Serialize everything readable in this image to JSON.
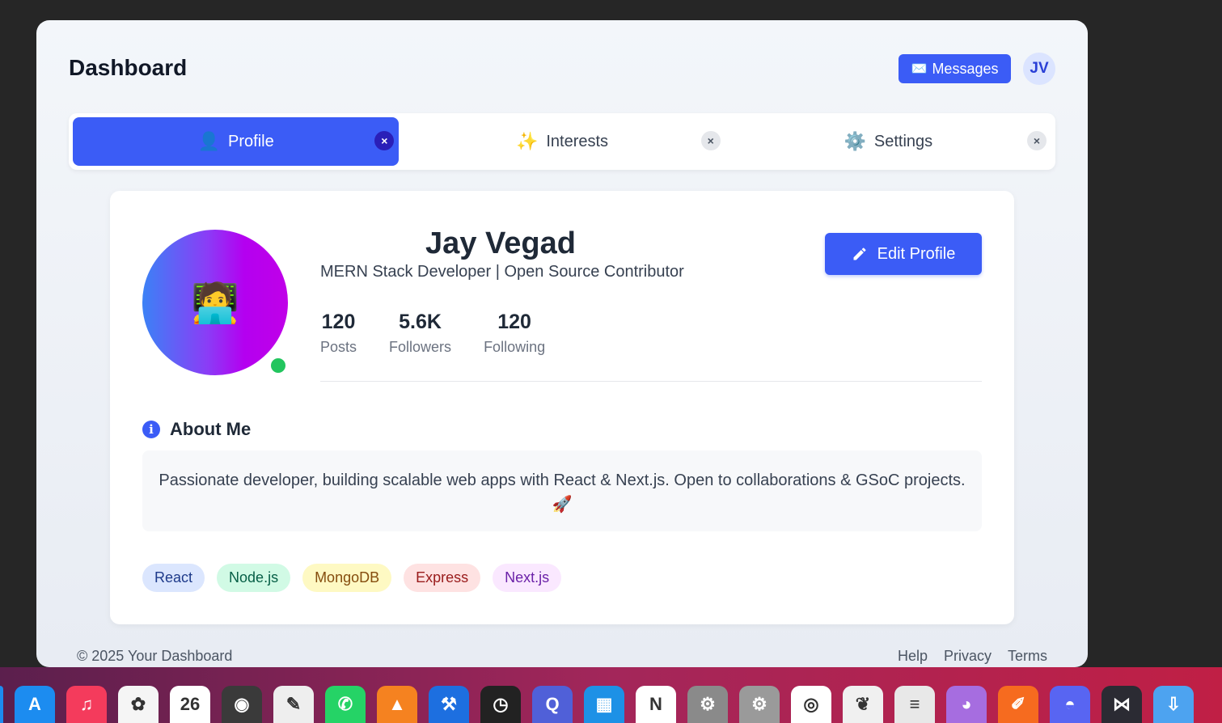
{
  "header": {
    "title": "Dashboard",
    "messages_icon": "✉️",
    "messages_label": "Messages",
    "avatar_initials": "JV"
  },
  "tabs": [
    {
      "icon": "👤",
      "label": "Profile",
      "active": true,
      "close": "×"
    },
    {
      "icon": "✨",
      "label": "Interests",
      "active": false,
      "close": "×"
    },
    {
      "icon": "⚙️",
      "label": "Settings",
      "active": false,
      "close": "×"
    }
  ],
  "profile": {
    "avatar_emoji": "🧑‍💻",
    "name": "Jay Vegad",
    "role": "MERN Stack Developer | Open Source Contributor",
    "edit_label": "Edit Profile",
    "stats": [
      {
        "value": "120",
        "label": "Posts"
      },
      {
        "value": "5.6K",
        "label": "Followers"
      },
      {
        "value": "120",
        "label": "Following"
      }
    ]
  },
  "about": {
    "heading": "About Me",
    "text": "Passionate developer, building scalable web apps with React & Next.js. Open to collaborations & GSoC projects. 🚀"
  },
  "tags": [
    {
      "label": "React",
      "bg": "#dbe6fe",
      "fg": "#1e3a8a"
    },
    {
      "label": "Node.js",
      "bg": "#d1fae5",
      "fg": "#065f46"
    },
    {
      "label": "MongoDB",
      "bg": "#fef9c3",
      "fg": "#854d0e"
    },
    {
      "label": "Express",
      "bg": "#fee2e2",
      "fg": "#991b1b"
    },
    {
      "label": "Next.js",
      "bg": "#fae8ff",
      "fg": "#6b21a8"
    }
  ],
  "footer": {
    "copyright": "© 2025 Your Dashboard",
    "links": [
      "Help",
      "Privacy",
      "Terms"
    ]
  },
  "colors": {
    "accent": "#3b5cf6",
    "online": "#22c55e"
  },
  "dock": [
    {
      "name": "app-store-icon",
      "bg": "#1c8cf0",
      "glyph": "A"
    },
    {
      "name": "music-icon",
      "bg": "#f43b5c",
      "glyph": "♫"
    },
    {
      "name": "photos-icon",
      "bg": "#f5f5f5",
      "glyph": "✿"
    },
    {
      "name": "calendar-icon",
      "bg": "#ffffff",
      "glyph": "26"
    },
    {
      "name": "obs-icon",
      "bg": "#3a3a3a",
      "glyph": "◉"
    },
    {
      "name": "textedit-icon",
      "bg": "#eeeeee",
      "glyph": "✎"
    },
    {
      "name": "whatsapp-icon",
      "bg": "#25d366",
      "glyph": "✆"
    },
    {
      "name": "vlc-icon",
      "bg": "#f58220",
      "glyph": "▲"
    },
    {
      "name": "xcode-icon",
      "bg": "#1d6fe0",
      "glyph": "⚒"
    },
    {
      "name": "clock-icon",
      "bg": "#222222",
      "glyph": "◷"
    },
    {
      "name": "quicktime-icon",
      "bg": "#5060d8",
      "glyph": "Q"
    },
    {
      "name": "docker-icon",
      "bg": "#1d91e6",
      "glyph": "▦"
    },
    {
      "name": "notion-icon",
      "bg": "#ffffff",
      "glyph": "N"
    },
    {
      "name": "system-settings-icon",
      "bg": "#8a8a8a",
      "glyph": "⚙"
    },
    {
      "name": "settings-alt-icon",
      "bg": "#9a9a9a",
      "glyph": "⚙"
    },
    {
      "name": "chrome-icon",
      "bg": "#ffffff",
      "glyph": "◎"
    },
    {
      "name": "mongodb-compass-icon",
      "bg": "#f0f0f0",
      "glyph": "❦"
    },
    {
      "name": "database-icon",
      "bg": "#e8e8e8",
      "glyph": "≡"
    },
    {
      "name": "github-desktop-icon",
      "bg": "#a66de0",
      "glyph": "◕"
    },
    {
      "name": "pen-app-icon",
      "bg": "#f66b1f",
      "glyph": "✐"
    },
    {
      "name": "discord-icon",
      "bg": "#5865f2",
      "glyph": "◓"
    },
    {
      "name": "vscode-icon",
      "bg": "#2b2b33",
      "glyph": "⋈"
    },
    {
      "name": "downloads-folder-icon",
      "bg": "#4da3f0",
      "glyph": "⇩"
    }
  ]
}
